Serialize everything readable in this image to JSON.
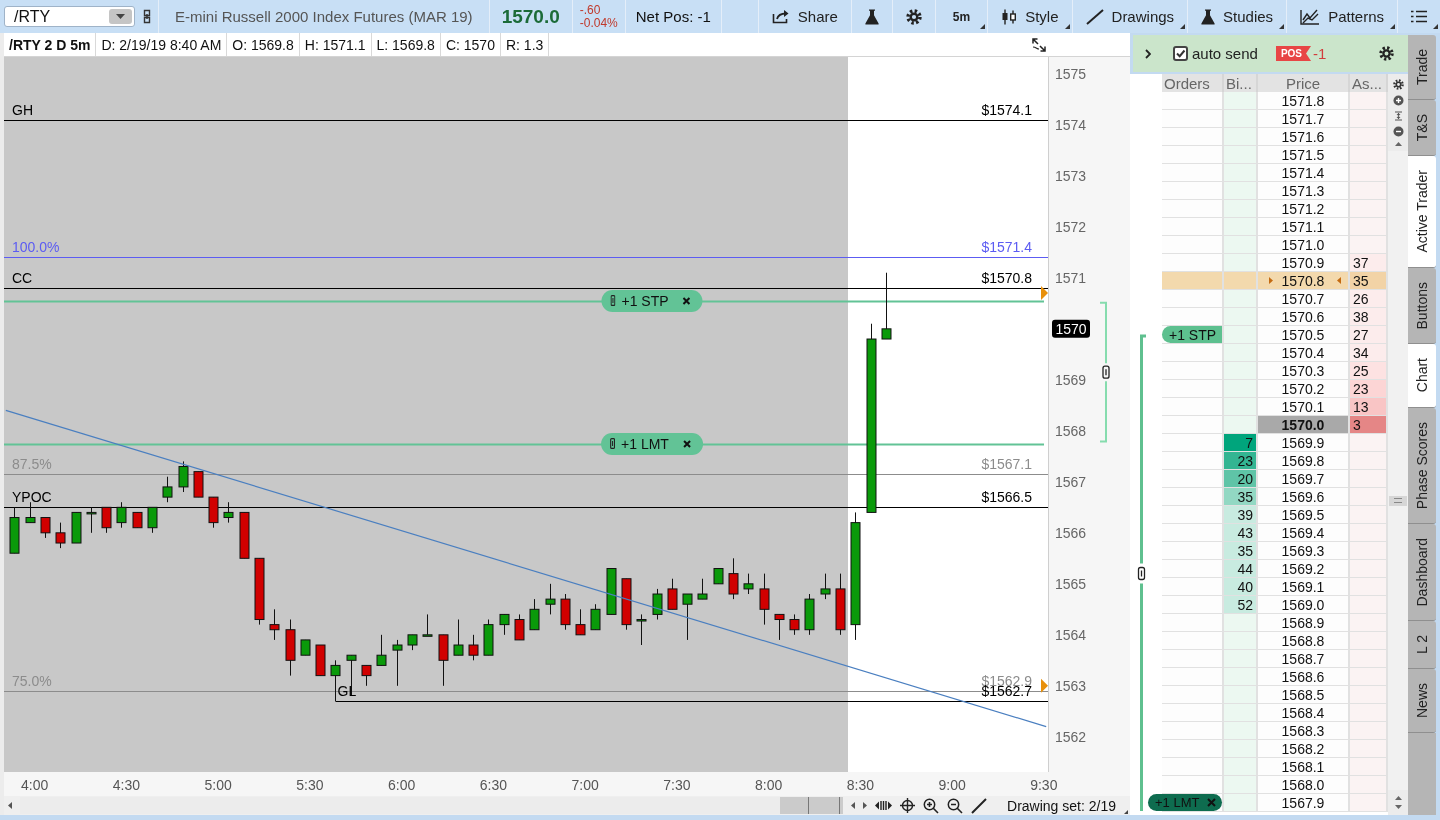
{
  "toolbar": {
    "symbol": "/RTY",
    "description": "E-mini Russell 2000 Index Futures (MAR 19)",
    "last": "1570.0",
    "change": "-.60",
    "change_pct": "-0.04%",
    "net_pos": "Net Pos: -1",
    "buttons": [
      {
        "kind": "share",
        "label": "Share",
        "dropdown": false
      },
      {
        "kind": "flask",
        "dropdown": false
      },
      {
        "kind": "settings",
        "dropdown": false
      },
      {
        "kind": "interval",
        "label": "5m",
        "dropdown": true
      },
      {
        "kind": "style",
        "label": "Style",
        "dropdown": true
      },
      {
        "kind": "drawings",
        "label": "Drawings",
        "dropdown": true
      },
      {
        "kind": "studies",
        "label": "Studies",
        "dropdown": true
      },
      {
        "kind": "patterns",
        "label": "Patterns",
        "dropdown": true
      },
      {
        "kind": "menu",
        "dropdown": true
      }
    ]
  },
  "chart": {
    "info_bar": {
      "title": "/RTY 2 D 5m",
      "fields": [
        "D: 2/19/19 8:40 AM",
        "O: 1569.8",
        "H: 1571.1",
        "L: 1569.8",
        "C: 1570",
        "R: 1.3"
      ]
    },
    "chart_data": [
      {
        "type": "candlestick",
        "x": [
          3.9167,
          4,
          4.0833,
          4.1667,
          4.25,
          4.3333,
          4.4167,
          4.5,
          4.5833,
          4.6667,
          4.75,
          4.8333,
          4.9167,
          5,
          5.0833,
          5.1667,
          5.25,
          5.3333,
          5.4167,
          5.5,
          5.5833,
          5.6667,
          5.75,
          5.8333,
          5.9167,
          6,
          6.0833,
          6.1667,
          6.25,
          6.3333,
          6.4167,
          6.5,
          6.5833,
          6.6667,
          6.75,
          6.8333,
          6.9167,
          7,
          7.0833,
          7.1667,
          7.25,
          7.3333,
          7.4167,
          7.5,
          7.5833,
          7.6667,
          7.75,
          7.8333,
          7.9167,
          8,
          8.0833,
          8.1667,
          8.25,
          8.3333,
          8.4167,
          8.5,
          8.5833,
          8.6667
        ],
        "ohlc": [
          [
            1565.6,
            1566.5,
            1565.6,
            1566.3
          ],
          [
            1566.2,
            1566.6,
            1566.2,
            1566.3
          ],
          [
            1566.3,
            1566.3,
            1565.9,
            1566.0
          ],
          [
            1566.0,
            1566.2,
            1565.7,
            1565.8
          ],
          [
            1565.8,
            1566.4,
            1565.8,
            1566.4
          ],
          [
            1566.4,
            1566.5,
            1566.0,
            1566.4
          ],
          [
            1566.5,
            1566.5,
            1566.0,
            1566.1
          ],
          [
            1566.2,
            1566.6,
            1566.1,
            1566.5
          ],
          [
            1566.4,
            1566.4,
            1566.1,
            1566.1
          ],
          [
            1566.1,
            1566.5,
            1566.0,
            1566.5
          ],
          [
            1566.7,
            1567.1,
            1566.6,
            1566.9
          ],
          [
            1566.9,
            1567.4,
            1566.8,
            1567.3
          ],
          [
            1567.2,
            1567.2,
            1566.7,
            1566.7
          ],
          [
            1566.7,
            1566.7,
            1566.1,
            1566.2
          ],
          [
            1566.3,
            1566.6,
            1566.2,
            1566.4
          ],
          [
            1566.4,
            1566.4,
            1565.5,
            1565.5
          ],
          [
            1565.5,
            1565.5,
            1564.2,
            1564.3
          ],
          [
            1564.2,
            1564.5,
            1563.9,
            1564.1
          ],
          [
            1564.1,
            1564.3,
            1563.2,
            1563.5
          ],
          [
            1563.6,
            1563.9,
            1563.6,
            1563.9
          ],
          [
            1563.8,
            1563.8,
            1563.2,
            1563.2
          ],
          [
            1563.2,
            1563.5,
            1562.7,
            1563.4
          ],
          [
            1563.5,
            1563.6,
            1562.8,
            1563.6
          ],
          [
            1563.4,
            1563.4,
            1563.0,
            1563.2
          ],
          [
            1563.4,
            1564.0,
            1563.4,
            1563.6
          ],
          [
            1563.7,
            1563.9,
            1563.0,
            1563.8
          ],
          [
            1563.8,
            1564.0,
            1563.7,
            1564.0
          ],
          [
            1564.0,
            1564.4,
            1564.0,
            1564.0
          ],
          [
            1564.0,
            1564.0,
            1563.0,
            1563.5
          ],
          [
            1563.6,
            1564.3,
            1563.6,
            1563.8
          ],
          [
            1563.8,
            1564.0,
            1563.5,
            1563.6
          ],
          [
            1563.6,
            1564.3,
            1563.6,
            1564.2
          ],
          [
            1564.2,
            1564.4,
            1564.0,
            1564.4
          ],
          [
            1564.3,
            1564.4,
            1563.9,
            1563.9
          ],
          [
            1564.1,
            1564.7,
            1564.1,
            1564.5
          ],
          [
            1564.6,
            1565.0,
            1564.4,
            1564.7
          ],
          [
            1564.7,
            1564.8,
            1564.1,
            1564.2
          ],
          [
            1564.2,
            1564.5,
            1564.0,
            1564.0
          ],
          [
            1564.1,
            1564.6,
            1564.1,
            1564.5
          ],
          [
            1564.4,
            1565.3,
            1564.4,
            1565.3
          ],
          [
            1565.1,
            1565.1,
            1564.1,
            1564.2
          ],
          [
            1564.3,
            1564.4,
            1563.8,
            1564.3
          ],
          [
            1564.4,
            1564.9,
            1564.3,
            1564.8
          ],
          [
            1564.9,
            1565.1,
            1564.5,
            1564.5
          ],
          [
            1564.6,
            1564.8,
            1563.9,
            1564.8
          ],
          [
            1564.7,
            1565.1,
            1564.7,
            1564.8
          ],
          [
            1565.0,
            1565.3,
            1565.0,
            1565.3
          ],
          [
            1565.2,
            1565.5,
            1564.7,
            1564.8
          ],
          [
            1564.9,
            1565.2,
            1564.8,
            1565.0
          ],
          [
            1564.9,
            1565.2,
            1564.2,
            1564.5
          ],
          [
            1564.4,
            1564.4,
            1563.9,
            1564.3
          ],
          [
            1564.3,
            1564.4,
            1564.0,
            1564.1
          ],
          [
            1564.1,
            1564.8,
            1564.0,
            1564.7
          ],
          [
            1564.8,
            1565.2,
            1564.7,
            1564.9
          ],
          [
            1564.9,
            1565.2,
            1564.0,
            1564.1
          ],
          [
            1564.2,
            1566.4,
            1563.9,
            1566.2
          ],
          [
            1566.4,
            1570.1,
            1566.4,
            1569.8
          ],
          [
            1569.8,
            1571.1,
            1569.8,
            1570.0
          ]
        ],
        "xlim": [
          3.86,
          9.55
        ],
        "ylim": [
          1561.31,
          1575.33
        ],
        "xticks": [
          {
            "value": 4,
            "label": "4:00"
          },
          {
            "value": 4.5,
            "label": "4:30"
          },
          {
            "value": 5,
            "label": "5:00"
          },
          {
            "value": 5.5,
            "label": "5:30"
          },
          {
            "value": 6,
            "label": "6:00"
          },
          {
            "value": 6.5,
            "label": "6:30"
          },
          {
            "value": 7,
            "label": "7:00"
          },
          {
            "value": 7.5,
            "label": "7:30"
          },
          {
            "value": 8,
            "label": "8:00"
          },
          {
            "value": 8.5,
            "label": "8:30"
          },
          {
            "value": 9,
            "label": "9:00"
          },
          {
            "value": 9.5,
            "label": "9:30"
          }
        ],
        "yticks": [
          1562,
          1563,
          1564,
          1565,
          1566,
          1567,
          1568,
          1569,
          1571,
          1572,
          1573,
          1574,
          1575
        ],
        "series": [
          {
            "type": "line",
            "x": [
              3.87,
              9.54
            ],
            "values": [
              1568.4,
              1562.2
            ],
            "color": "#4a7fc0"
          },
          {
            "type": "scatter",
            "x": [
              9.55,
              9.55
            ],
            "values": [
              1570.7,
              1563.0
            ],
            "color": "#e8900c",
            "marker": "triangle"
          }
        ],
        "bands": [
          {
            "axis": "x",
            "from": 3.86,
            "to": 8.46,
            "color": "#c8c8c8"
          }
        ],
        "ref_lines": [
          {
            "axis": "y",
            "value": 1574.1,
            "label": "$1574.1",
            "color": "#000000"
          },
          {
            "axis": "y",
            "value": 1571.4,
            "label": "$1571.4",
            "color": "#5c5cf2"
          },
          {
            "axis": "y",
            "value": 1570.8,
            "label": "$1570.8",
            "color": "#000000"
          },
          {
            "axis": "y",
            "value": 1570.55,
            "label": "+1 STP",
            "color": "#62c396"
          },
          {
            "axis": "y",
            "value": 1567.75,
            "label": "+1 LMT",
            "color": "#62c396"
          },
          {
            "axis": "y",
            "value": 1567.15,
            "label": "$1567.1",
            "color": "#8c8c8c"
          },
          {
            "axis": "y",
            "value": 1566.5,
            "label": "$1566.5",
            "color": "#000000"
          },
          {
            "axis": "y",
            "value": 1562.9,
            "label": "$1562.9",
            "color": "#8c8c8c"
          },
          {
            "axis": "y",
            "value": 1562.7,
            "label": "$1562.7",
            "color": "#000000"
          }
        ]
      }
    ],
    "line_tags": [
      {
        "kind": "level",
        "name": "GH",
        "anchored": false
      },
      {
        "kind": "level",
        "name": "100.0%",
        "anchored": false
      },
      {
        "kind": "level",
        "name": "CC",
        "anchored": false
      },
      {
        "kind": "order"
      },
      {
        "kind": "order"
      },
      {
        "kind": "level",
        "name": "87.5%",
        "anchored": false
      },
      {
        "kind": "level",
        "name": "YPOC",
        "anchored": false
      },
      {
        "kind": "level",
        "name": "75.0%",
        "anchored": false
      },
      {
        "kind": "level",
        "name": "GL",
        "anchored": true
      }
    ],
    "last_price_label": "1570",
    "footer": {
      "drawing_set": "Drawing set: 2/19"
    }
  },
  "active_trader": {
    "auto_send": {
      "label": "auto send",
      "checked": true
    },
    "position": {
      "badge": "POS",
      "value": "-1"
    },
    "columns": [
      "Orders",
      "Bi...",
      "Price",
      "As..."
    ],
    "rows": [
      {
        "price": "1571.8",
        "highlighted": false,
        "last": false
      },
      {
        "price": "1571.7",
        "highlighted": false,
        "last": false
      },
      {
        "price": "1571.6",
        "highlighted": false,
        "last": false
      },
      {
        "price": "1571.5",
        "highlighted": false,
        "last": false
      },
      {
        "price": "1571.4",
        "highlighted": false,
        "last": false
      },
      {
        "price": "1571.3",
        "highlighted": false,
        "last": false
      },
      {
        "price": "1571.2",
        "highlighted": false,
        "last": false
      },
      {
        "price": "1571.1",
        "highlighted": false,
        "last": false
      },
      {
        "price": "1571.0",
        "highlighted": false,
        "last": false
      },
      {
        "price": "1570.9",
        "ask": {
          "size": "37",
          "color": "#fcecec"
        },
        "highlighted": false,
        "last": false
      },
      {
        "price": "1570.8",
        "ask": {
          "size": "35",
          "color": "#f2d3a6"
        },
        "highlighted": true,
        "last": false
      },
      {
        "price": "1570.7",
        "ask": {
          "size": "26",
          "color": "#fcecec"
        },
        "highlighted": false,
        "last": false
      },
      {
        "price": "1570.6",
        "ask": {
          "size": "38",
          "color": "#fcecec"
        },
        "highlighted": false,
        "last": false
      },
      {
        "price": "1570.5",
        "ask": {
          "size": "27",
          "color": "#fcecec"
        },
        "order": {
          "label": "+1 STP",
          "kind": "stop"
        },
        "highlighted": false,
        "last": false
      },
      {
        "price": "1570.4",
        "ask": {
          "size": "34",
          "color": "#fcecec"
        },
        "highlighted": false,
        "last": false
      },
      {
        "price": "1570.3",
        "ask": {
          "size": "25",
          "color": "#fde2e2"
        },
        "highlighted": false,
        "last": false
      },
      {
        "price": "1570.2",
        "ask": {
          "size": "23",
          "color": "#fcd5d5"
        },
        "highlighted": false,
        "last": false
      },
      {
        "price": "1570.1",
        "ask": {
          "size": "13",
          "color": "#f9c5c5"
        },
        "highlighted": false,
        "last": false
      },
      {
        "price": "1570.0",
        "ask": {
          "size": "3",
          "color": "#e58686"
        },
        "highlighted": false,
        "last": true
      },
      {
        "price": "1569.9",
        "bid": {
          "size": "7",
          "color": "#00a57c"
        },
        "highlighted": false,
        "last": false
      },
      {
        "price": "1569.8",
        "bid": {
          "size": "23",
          "color": "#33b592"
        },
        "highlighted": false,
        "last": false
      },
      {
        "price": "1569.7",
        "bid": {
          "size": "20",
          "color": "#5fc4a7"
        },
        "highlighted": false,
        "last": false
      },
      {
        "price": "1569.6",
        "bid": {
          "size": "35",
          "color": "#92d8c3"
        },
        "highlighted": false,
        "last": false
      },
      {
        "price": "1569.5",
        "bid": {
          "size": "39",
          "color": "#c8ebe0"
        },
        "highlighted": false,
        "last": false
      },
      {
        "price": "1569.4",
        "bid": {
          "size": "43",
          "color": "#c8ebe0"
        },
        "highlighted": false,
        "last": false
      },
      {
        "price": "1569.3",
        "bid": {
          "size": "35",
          "color": "#c8ebe0"
        },
        "highlighted": false,
        "last": false
      },
      {
        "price": "1569.2",
        "bid": {
          "size": "44",
          "color": "#c8ebe0"
        },
        "highlighted": false,
        "last": false
      },
      {
        "price": "1569.1",
        "bid": {
          "size": "40",
          "color": "#c8ebe0"
        },
        "highlighted": false,
        "last": false
      },
      {
        "price": "1569.0",
        "bid": {
          "size": "52",
          "color": "#c8ebe0"
        },
        "highlighted": false,
        "last": false
      },
      {
        "price": "1568.9",
        "highlighted": false,
        "last": false
      },
      {
        "price": "1568.8",
        "highlighted": false,
        "last": false
      },
      {
        "price": "1568.7",
        "highlighted": false,
        "last": false
      },
      {
        "price": "1568.6",
        "highlighted": false,
        "last": false
      },
      {
        "price": "1568.5",
        "highlighted": false,
        "last": false
      },
      {
        "price": "1568.4",
        "highlighted": false,
        "last": false
      },
      {
        "price": "1568.3",
        "highlighted": false,
        "last": false
      },
      {
        "price": "1568.2",
        "highlighted": false,
        "last": false
      },
      {
        "price": "1568.1",
        "highlighted": false,
        "last": false
      },
      {
        "price": "1568.0",
        "highlighted": false,
        "last": false
      },
      {
        "price": "1567.9",
        "order": {
          "label": "+1 LMT",
          "kind": "limit"
        },
        "highlighted": false,
        "last": false
      }
    ]
  },
  "side_tabs": [
    {
      "label": "Trade",
      "selected": false
    },
    {
      "label": "T&S",
      "selected": false
    },
    {
      "label": "Active Trader",
      "selected": true
    },
    {
      "label": "Buttons",
      "selected": false
    },
    {
      "label": "Chart",
      "selected": true
    },
    {
      "label": "Phase Scores",
      "selected": false
    },
    {
      "label": "Dashboard",
      "selected": false
    },
    {
      "label": "L 2",
      "selected": false
    },
    {
      "label": "News",
      "selected": false
    }
  ]
}
